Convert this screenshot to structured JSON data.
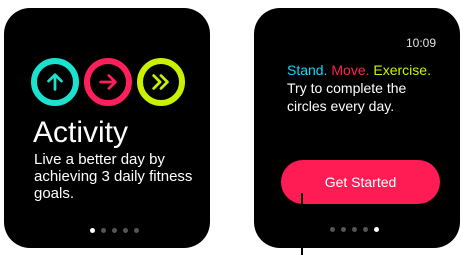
{
  "screen1": {
    "title": "Activity",
    "subtitle": "Live a better day by achieving 3 daily fitness goals.",
    "rings": [
      {
        "name": "stand-ring-icon",
        "color": "#19e3cf",
        "icon": "arrow-up"
      },
      {
        "name": "move-ring-icon",
        "color": "#ff1f5a",
        "icon": "arrow-right"
      },
      {
        "name": "exercise-ring-icon",
        "color": "#c8f000",
        "icon": "double-chevron-right"
      }
    ],
    "page_indicator": {
      "total": 5,
      "active": 1
    }
  },
  "screen2": {
    "time": "10:09",
    "stand": "Stand.",
    "move": "Move.",
    "exercise": "Exercise.",
    "description": "Try to complete the circles every day.",
    "button_label": "Get Started",
    "page_indicator": {
      "total": 5,
      "active": 5
    }
  }
}
